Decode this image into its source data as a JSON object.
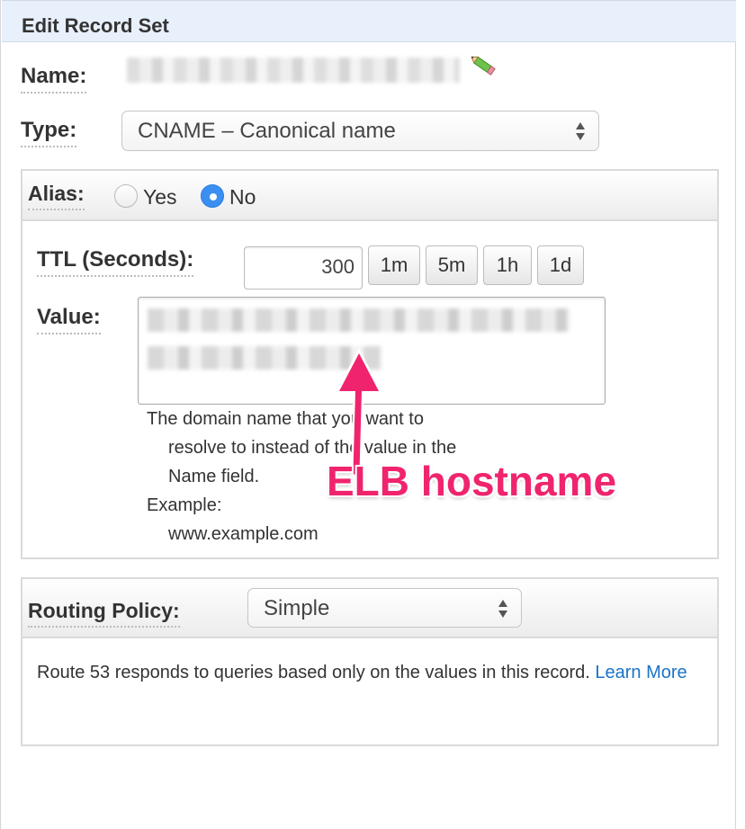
{
  "header": {
    "title": "Edit Record Set"
  },
  "name_field": {
    "label": "Name:"
  },
  "type_field": {
    "label": "Type:",
    "selected": "CNAME – Canonical name"
  },
  "alias": {
    "label": "Alias:",
    "options": [
      "Yes",
      "No"
    ],
    "selected": "No"
  },
  "ttl": {
    "label": "TTL (Seconds):",
    "value": "300",
    "presets": [
      "1m",
      "5m",
      "1h",
      "1d"
    ]
  },
  "value_field": {
    "label": "Value:",
    "help_lines": [
      "The domain name that you want to",
      "resolve to instead of the value in the",
      "Name field.",
      "Example:",
      "www.example.com"
    ]
  },
  "annotation": {
    "text": "ELB hostname",
    "color": "#f0246e"
  },
  "routing_policy": {
    "label": "Routing Policy:",
    "selected": "Simple",
    "description": "Route 53 responds to queries based only on the values in this record.",
    "link_text": "Learn More"
  },
  "colors": {
    "accent_blue": "#3b8ff3",
    "link": "#1a73c8",
    "header_bg": "#e8f0fc"
  }
}
